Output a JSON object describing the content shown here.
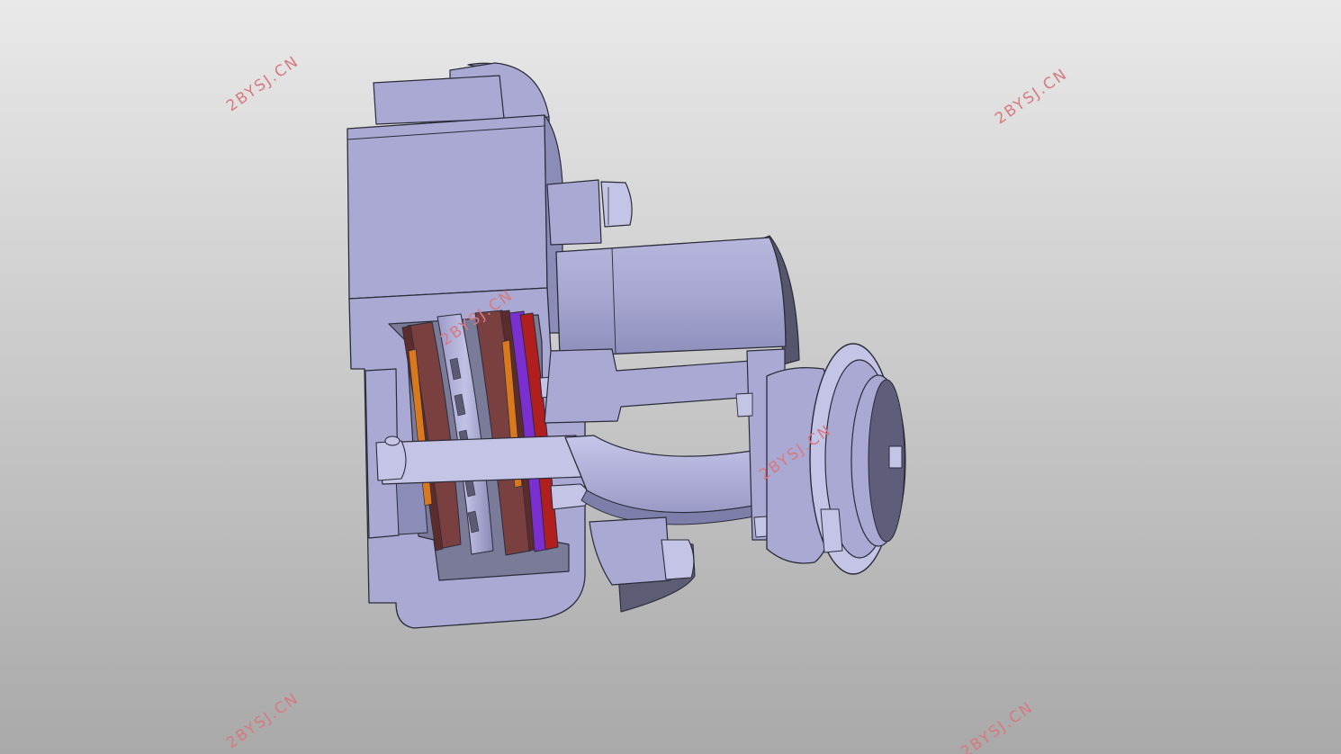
{
  "viewport": {
    "background_top": "#e9e9e9",
    "background_bottom": "#a9a9a9"
  },
  "model": {
    "body_color": "#a9a9d3",
    "body_shade_color": "#8c8cb8",
    "body_light_color": "#c4c4e6",
    "edge_color": "#2b2b3a",
    "friction_disc_color": "#7a3f3f",
    "friction_disc_shade": "#5c2c2c",
    "spacer_color": "#d9791c",
    "plate_color": "#7b2fd0",
    "red_plate_color": "#b01e1e"
  },
  "watermarks": [
    {
      "text": "2BYSJ.CN"
    },
    {
      "text": "2BYSJ.CN"
    },
    {
      "text": "2BYSJ.CN"
    },
    {
      "text": "2BYSJ.CN"
    },
    {
      "text": "2BYSJ.CN"
    },
    {
      "text": "2BYSJ.CN"
    }
  ]
}
